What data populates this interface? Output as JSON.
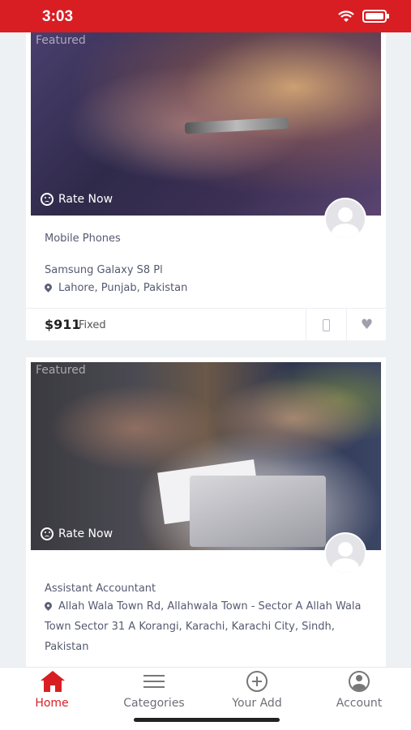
{
  "status_bar": {
    "time": "3:03"
  },
  "listings": [
    {
      "featured": "Featured",
      "rate_label": "Rate Now",
      "category": "Mobile Phones",
      "title": "Samsung Galaxy S8 Pl",
      "location": "Lahore, Punjab, Pakistan",
      "price": "$911",
      "price_type": "Fixed"
    },
    {
      "featured": "Featured",
      "rate_label": "Rate Now",
      "title": "Assistant Accountant",
      "location": "Allah Wala Town Rd, Allahwala Town - Sector A Allah Wala Town Sector 31 A Korangi, Karachi, Karachi City, Sindh, Pakistan"
    }
  ],
  "bottom_nav": {
    "items": [
      {
        "label": "Home",
        "icon": "home-icon",
        "active": true
      },
      {
        "label": "Categories",
        "icon": "menu-icon",
        "active": false
      },
      {
        "label": "Your Add",
        "icon": "plus-circle-icon",
        "active": false
      },
      {
        "label": "Account",
        "icon": "user-circle-icon",
        "active": false
      }
    ],
    "active_color": "#d81e23"
  },
  "colors": {
    "brand": "#d81e23",
    "text_muted": "#555a70"
  }
}
